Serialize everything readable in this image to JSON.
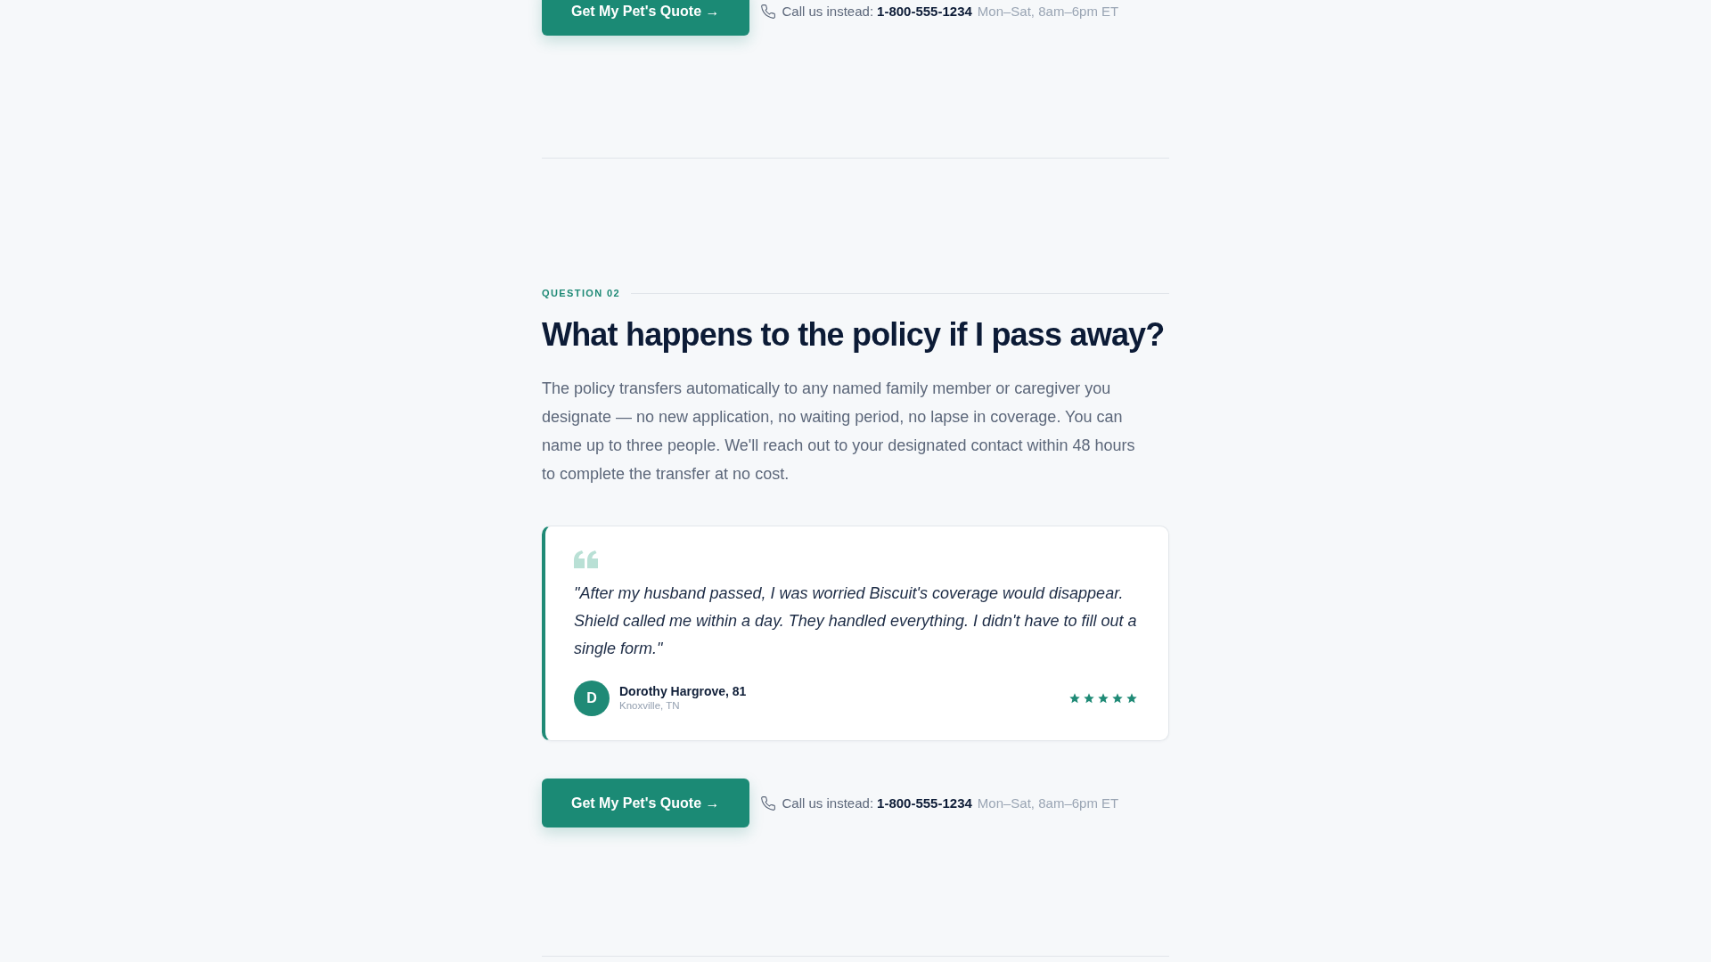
{
  "sections": [
    {
      "cta": {
        "button": "Get My Pet's Quote →",
        "call_label": "Call us instead:",
        "phone": "1-800-555-1234",
        "hours": "Mon–Sat, 8am–6pm ET"
      }
    },
    {
      "eyebrow": "QUESTION 02",
      "heading": "What happens to the policy if I pass away?",
      "answer": "The policy transfers automatically to any named family member or caregiver you designate — no new application, no waiting period, no lapse in coverage. You can name up to three people. We'll reach out to your designated contact within 48 hours to complete the transfer at no cost.",
      "testimonial": {
        "quote": "\"After my husband passed, I was worried Biscuit's coverage would disappear. Shield called me within a day. They handled everything. I didn't have to fill out a single form.\"",
        "avatar_initial": "D",
        "name": "Dorothy Hargrove, 81",
        "location": "Knoxville, TN",
        "stars": 5
      },
      "cta": {
        "button": "Get My Pet's Quote →",
        "call_label": "Call us instead:",
        "phone": "1-800-555-1234",
        "hours": "Mon–Sat, 8am–6pm ET"
      }
    }
  ]
}
